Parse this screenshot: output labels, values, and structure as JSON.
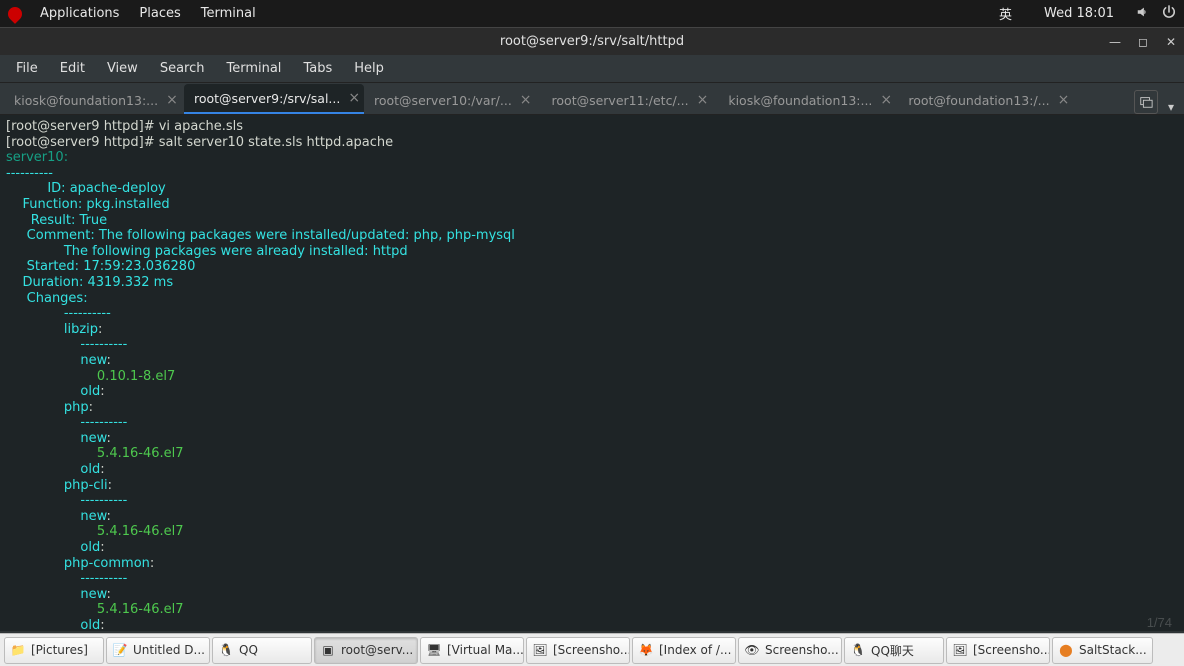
{
  "topbar": {
    "applications": "Applications",
    "places": "Places",
    "terminal": "Terminal",
    "ime": "英",
    "clock": "Wed 18:01"
  },
  "window": {
    "title": "root@server9:/srv/salt/httpd"
  },
  "menu": {
    "file": "File",
    "edit": "Edit",
    "view": "View",
    "search": "Search",
    "terminal": "Terminal",
    "tabs": "Tabs",
    "help": "Help"
  },
  "tabs": [
    {
      "label": "kiosk@foundation13:...",
      "active": false
    },
    {
      "label": "root@server9:/srv/sal...",
      "active": true
    },
    {
      "label": "root@server10:/var/...",
      "active": false
    },
    {
      "label": "root@server11:/etc/...",
      "active": false
    },
    {
      "label": "kiosk@foundation13:...",
      "active": false
    },
    {
      "label": "root@foundation13:/...",
      "active": false
    }
  ],
  "terminal": {
    "prompt1_pre": "[root@server9 httpd]# ",
    "cmd1": "vi apache.sls",
    "prompt2_pre": "[root@server9 httpd]# ",
    "cmd2": "salt server10 state.sls httpd.apache",
    "minion": "server10:",
    "dashes10": "----------",
    "id_k": "          ID:",
    "id_v": " apache-deploy",
    "fn_k": "    Function:",
    "fn_v": " pkg.installed",
    "rs_k": "      Result:",
    "rs_v": " True",
    "cm_k": "     Comment:",
    "cm_v1": " The following packages were installed/updated: php, php-mysql",
    "cm_v2": "              The following packages were already installed: httpd",
    "st_k": "     Started:",
    "st_v": " 17:59:23.036280",
    "du_k": "    Duration:",
    "du_v": " 4319.332 ms",
    "ch_k": "     Changes:",
    "pkg_libzip": "              libzip",
    "pkg_php": "              php",
    "pkg_phpcli": "              php-cli",
    "pkg_phpcommon": "              php-common",
    "dash14": "              ----------",
    "dash18": "                  ----------",
    "new_k": "                  new",
    "old_k": "                  old",
    "ver_libzip": "                      0.10.1-8.el7",
    "ver_php": "                      5.4.16-46.el7",
    "colon": ":"
  },
  "taskbar": {
    "items": [
      {
        "label": "[Pictures]",
        "icon": "folder"
      },
      {
        "label": "Untitled D...",
        "icon": "edit"
      },
      {
        "label": "QQ",
        "icon": "qq"
      },
      {
        "label": "root@serv...",
        "icon": "term",
        "active": true
      },
      {
        "label": "[Virtual Ma...",
        "icon": "vm"
      },
      {
        "label": "[Screensho...",
        "icon": "img"
      },
      {
        "label": "[Index of /...",
        "icon": "ff"
      },
      {
        "label": "Screensho...",
        "icon": "eye"
      },
      {
        "label": "QQ聊天",
        "icon": "qq"
      },
      {
        "label": "[Screensho...",
        "icon": "img"
      },
      {
        "label": "SaltStack...",
        "icon": "ff2"
      }
    ]
  },
  "watermark": "1/74"
}
